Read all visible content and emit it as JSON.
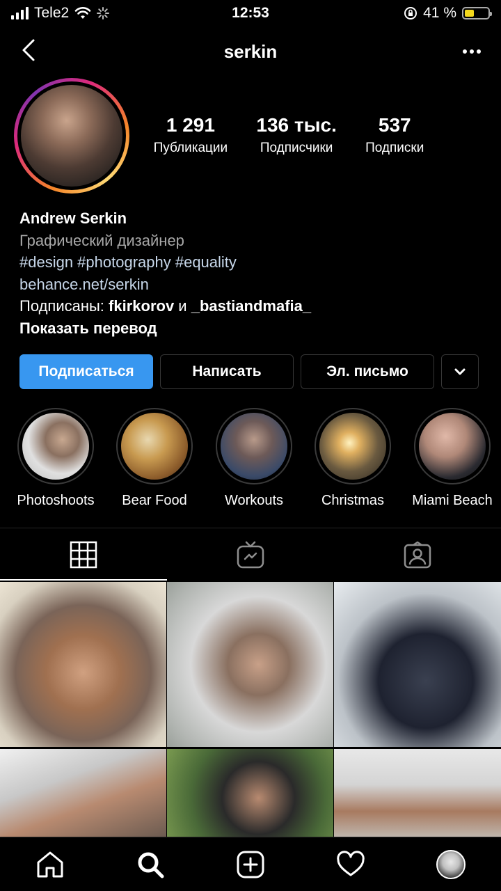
{
  "status_bar": {
    "carrier": "Tele2",
    "time": "12:53",
    "battery_percent": "41 %",
    "battery_level": 0.41,
    "battery_color": "#f4d81c"
  },
  "header": {
    "username": "serkin"
  },
  "stats": [
    {
      "value": "1 291",
      "label": "Публикации"
    },
    {
      "value": "136 тыс.",
      "label": "Подписчики"
    },
    {
      "value": "537",
      "label": "Подписки"
    }
  ],
  "bio": {
    "name": "Andrew Serkin",
    "category": "Графический дизайнер",
    "hashtags": "#design #photography #equality",
    "link": "behance.net/serkin",
    "followed_by_prefix": "Подписаны: ",
    "followed_by_user1": "fkirkorov",
    "followed_by_and": " и ",
    "followed_by_user2": "_bastiandmafia_",
    "show_translation": "Показать перевод"
  },
  "actions": {
    "follow": "Подписаться",
    "message": "Написать",
    "email": "Эл. письмо"
  },
  "highlights": [
    {
      "label": "Photoshoots"
    },
    {
      "label": "Bear Food"
    },
    {
      "label": "Workouts"
    },
    {
      "label": "Christmas"
    },
    {
      "label": "Miami Beach"
    }
  ],
  "tabs": [
    {
      "name": "grid-icon"
    },
    {
      "name": "igtv-icon"
    },
    {
      "name": "tagged-icon"
    }
  ],
  "colors": {
    "accent": "#3897f0",
    "background": "#000000",
    "link": "#c7d7ea",
    "muted": "#a8a8a8"
  },
  "bottom_nav": [
    "home-icon",
    "search-icon",
    "add-icon",
    "heart-icon",
    "profile-avatar"
  ]
}
